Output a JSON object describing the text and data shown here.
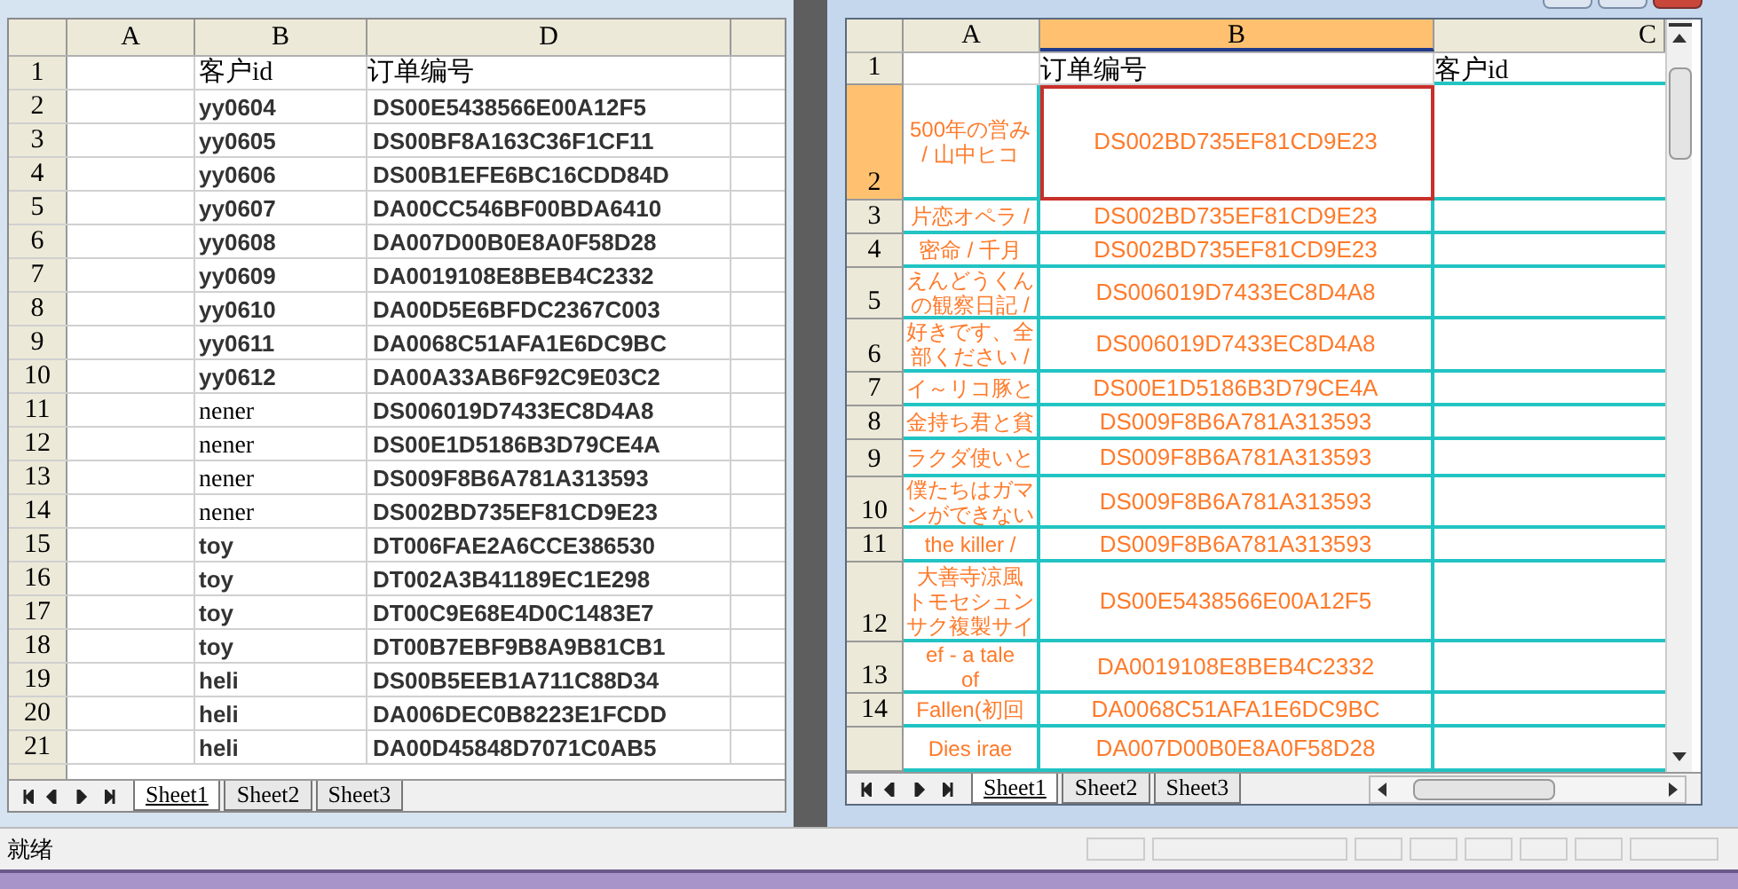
{
  "left_window": {
    "columns": [
      {
        "label": "A"
      },
      {
        "label": "B"
      },
      {
        "label": "D"
      }
    ],
    "rows": [
      {
        "number": "1",
        "kind": "header",
        "customer_id": "客户id",
        "order_no": "订单编号"
      },
      {
        "number": "2",
        "kind": "data",
        "bold": true,
        "customer_id": "yy0604",
        "order_no": "DS00E5438566E00A12F5"
      },
      {
        "number": "3",
        "kind": "data",
        "bold": true,
        "customer_id": "yy0605",
        "order_no": "DS00BF8A163C36F1CF11"
      },
      {
        "number": "4",
        "kind": "data",
        "bold": true,
        "customer_id": "yy0606",
        "order_no": "DS00B1EFE6BC16CDD84D"
      },
      {
        "number": "5",
        "kind": "data",
        "bold": true,
        "customer_id": "yy0607",
        "order_no": "DA00CC546BF00BDA6410"
      },
      {
        "number": "6",
        "kind": "data",
        "bold": true,
        "customer_id": "yy0608",
        "order_no": "DA007D00B0E8A0F58D28"
      },
      {
        "number": "7",
        "kind": "data",
        "bold": true,
        "customer_id": "yy0609",
        "order_no": "DA0019108E8BEB4C2332"
      },
      {
        "number": "8",
        "kind": "data",
        "bold": true,
        "customer_id": "yy0610",
        "order_no": "DA00D5E6BFDC2367C003"
      },
      {
        "number": "9",
        "kind": "data",
        "bold": true,
        "customer_id": "yy0611",
        "order_no": "DA0068C51AFA1E6DC9BC"
      },
      {
        "number": "10",
        "kind": "data",
        "bold": true,
        "customer_id": "yy0612",
        "order_no": "DA00A33AB6F92C9E03C2"
      },
      {
        "number": "11",
        "kind": "data",
        "bold": false,
        "customer_id": "nener",
        "order_no": "DS006019D7433EC8D4A8"
      },
      {
        "number": "12",
        "kind": "data",
        "bold": false,
        "customer_id": "nener",
        "order_no": "DS00E1D5186B3D79CE4A"
      },
      {
        "number": "13",
        "kind": "data",
        "bold": false,
        "customer_id": "nener",
        "order_no": "DS009F8B6A781A313593"
      },
      {
        "number": "14",
        "kind": "data",
        "bold": false,
        "customer_id": "nener",
        "order_no": "DS002BD735EF81CD9E23"
      },
      {
        "number": "15",
        "kind": "data",
        "bold": true,
        "customer_id": "toy",
        "order_no": "DT006FAE2A6CCE386530"
      },
      {
        "number": "16",
        "kind": "data",
        "bold": true,
        "customer_id": "toy",
        "order_no": "DT002A3B41189EC1E298"
      },
      {
        "number": "17",
        "kind": "data",
        "bold": true,
        "customer_id": "toy",
        "order_no": "DT00C9E68E4D0C1483E7"
      },
      {
        "number": "18",
        "kind": "data",
        "bold": true,
        "customer_id": "toy",
        "order_no": "DT00B7EBF9B8A9B81CB1"
      },
      {
        "number": "19",
        "kind": "data",
        "bold": true,
        "customer_id": "heli",
        "order_no": "DS00B5EEB1A711C88D34"
      },
      {
        "number": "20",
        "kind": "data",
        "bold": true,
        "customer_id": "heli",
        "order_no": "DA006DEC0B8223E1FCDD"
      },
      {
        "number": "21",
        "kind": "data",
        "bold": true,
        "customer_id": "heli",
        "order_no": "DA00D45848D7071C0AB5"
      }
    ],
    "sheet_tabs": [
      {
        "label": "Sheet1",
        "selected": true
      },
      {
        "label": "Sheet2",
        "selected": false
      },
      {
        "label": "Sheet3",
        "selected": false
      }
    ]
  },
  "right_window": {
    "columns": [
      {
        "label": "A",
        "selected": false
      },
      {
        "label": "B",
        "selected": true
      },
      {
        "label": "C",
        "selected": false
      }
    ],
    "rows": [
      {
        "number": "1",
        "kind": "header",
        "selected": false,
        "order_no": "订单编号",
        "customer_id": "客户id"
      },
      {
        "number": "2",
        "kind": "data",
        "selected": true,
        "title_lines": [
          "500年の営み",
          "/ 山中ヒコ"
        ],
        "order_no": "DS002BD735EF81CD9E23"
      },
      {
        "number": "3",
        "kind": "data",
        "selected": false,
        "title_lines": [
          "片恋オペラ /"
        ],
        "order_no": "DS002BD735EF81CD9E23"
      },
      {
        "number": "4",
        "kind": "data",
        "selected": false,
        "title_lines": [
          "密命 / 千月"
        ],
        "order_no": "DS002BD735EF81CD9E23"
      },
      {
        "number": "5",
        "kind": "data",
        "selected": false,
        "title_lines": [
          "えんどうくん",
          "の観察日記 /"
        ],
        "order_no": "DS006019D7433EC8D4A8"
      },
      {
        "number": "6",
        "kind": "data",
        "selected": false,
        "title_lines": [
          "好きです、全",
          "部ください /"
        ],
        "order_no": "DS006019D7433EC8D4A8"
      },
      {
        "number": "7",
        "kind": "data",
        "selected": false,
        "title_lines": [
          "イ～リコ豚と"
        ],
        "order_no": "DS00E1D5186B3D79CE4A"
      },
      {
        "number": "8",
        "kind": "data",
        "selected": false,
        "title_lines": [
          "金持ち君と貧"
        ],
        "order_no": "DS009F8B6A781A313593"
      },
      {
        "number": "9",
        "kind": "data",
        "selected": false,
        "title_lines": [
          "ラクダ使いと"
        ],
        "order_no": "DS009F8B6A781A313593"
      },
      {
        "number": "10",
        "kind": "data",
        "selected": false,
        "title_lines": [
          "僕たちはガマ",
          "ンができない"
        ],
        "order_no": "DS009F8B6A781A313593"
      },
      {
        "number": "11",
        "kind": "data",
        "selected": false,
        "title_lines": [
          "the killer /"
        ],
        "order_no": "DS009F8B6A781A313593"
      },
      {
        "number": "12",
        "kind": "data",
        "selected": false,
        "title_lines": [
          "大善寺涼風",
          "トモセシュン",
          "サク複製サイ"
        ],
        "order_no": "DS00E5438566E00A12F5"
      },
      {
        "number": "13",
        "kind": "data",
        "selected": false,
        "title_lines": [
          "ef - a tale",
          "of"
        ],
        "order_no": "DA0019108E8BEB4C2332"
      },
      {
        "number": "14",
        "kind": "data",
        "selected": false,
        "title_lines": [
          "Fallen(初回"
        ],
        "order_no": "DA0068C51AFA1E6DC9BC"
      },
      {
        "kind": "data",
        "selected": false,
        "title_lines": [
          "Dies irae"
        ],
        "order_no": "DA007D00B0E8A0F58D28"
      }
    ],
    "sheet_tabs": [
      {
        "label": "Sheet1",
        "selected": true
      },
      {
        "label": "Sheet2",
        "selected": false
      },
      {
        "label": "Sheet3",
        "selected": false
      }
    ]
  },
  "status_bar": {
    "text": "就绪"
  }
}
